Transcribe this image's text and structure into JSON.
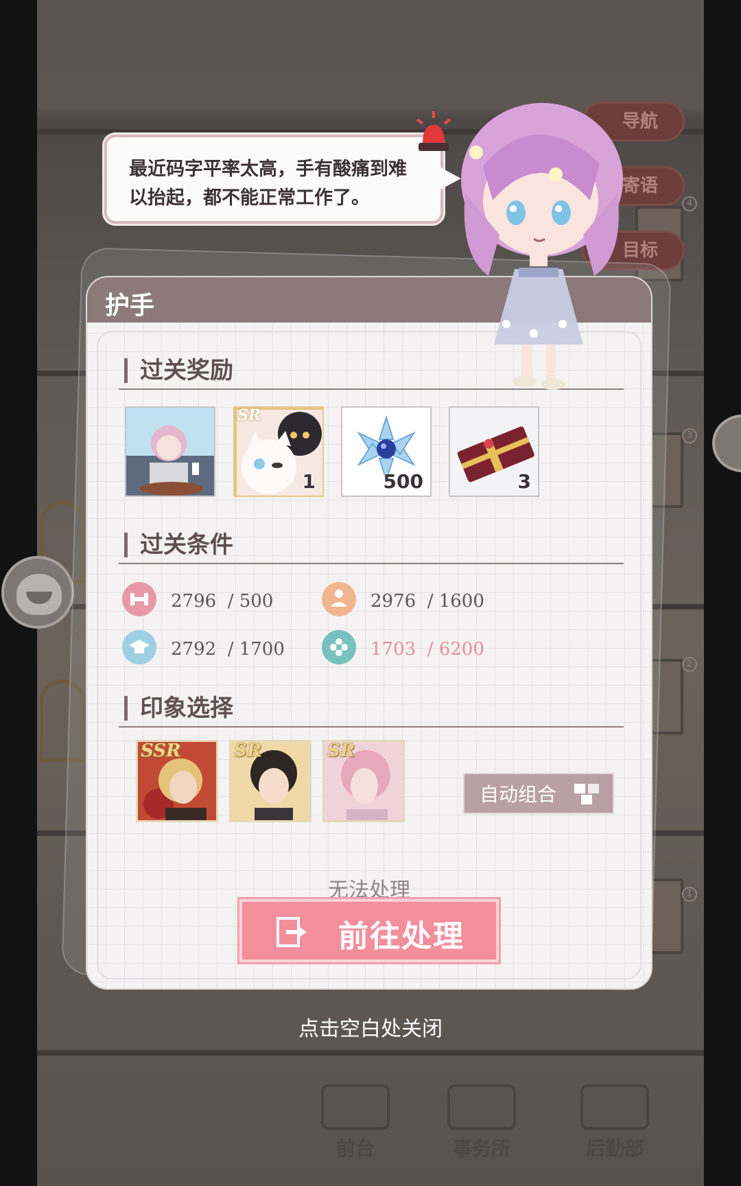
{
  "background": {
    "nav_buttons": [
      "导航",
      "寄语",
      "目标"
    ],
    "door_numbers": [
      "4",
      "3",
      "2",
      "1"
    ],
    "bottom_tabs": [
      "前台",
      "事务所",
      "后勤部"
    ]
  },
  "speech": {
    "text": "最近码字平率太高，手有酸痛到难以抬起，都不能正常工作了。"
  },
  "panel": {
    "title": "护手",
    "rewards_title": "过关奖励",
    "rewards": [
      {
        "name": "illustration-card",
        "qty": ""
      },
      {
        "name": "sr-cat-card",
        "qty": "1"
      },
      {
        "name": "crystal-snowflake",
        "qty": "500"
      },
      {
        "name": "red-ticket",
        "qty": "3"
      }
    ],
    "conditions_title": "过关条件",
    "conditions": [
      {
        "icon": "dumbbell-icon",
        "value": "2796",
        "target": "/ 500",
        "met": true,
        "color": "#e899a8"
      },
      {
        "icon": "person-icon",
        "value": "2976",
        "target": "/ 1600",
        "met": true,
        "color": "#f2b58f"
      },
      {
        "icon": "graduation-cap-icon",
        "value": "2792",
        "target": "/ 1700",
        "met": true,
        "color": "#9fcfe3"
      },
      {
        "icon": "flower-icon",
        "value": "1703",
        "target": "/ 6200",
        "met": false,
        "color": "#77c2bd"
      }
    ],
    "impression_title": "印象选择",
    "cards": [
      {
        "rarity": "SSR"
      },
      {
        "rarity": "SR"
      },
      {
        "rarity": "SR"
      }
    ],
    "auto_combine_label": "自动组合",
    "unable_label": "无法处理",
    "goto_label": "前往处理"
  },
  "close_hint": "点击空白处关闭",
  "colors": {
    "header": "#8c7a7b",
    "button": "#f38f9d",
    "unmet_text": "#e98b9a"
  }
}
